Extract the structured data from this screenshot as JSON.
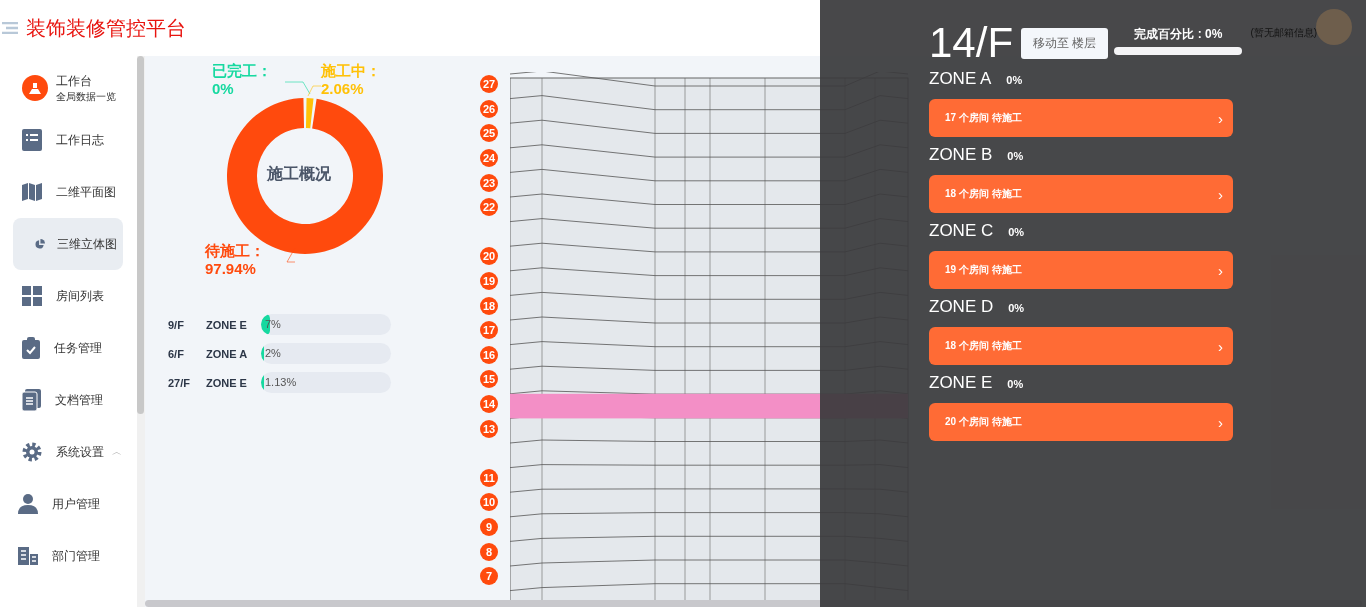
{
  "header": {
    "title": "装饰装修管控平台"
  },
  "sidebar": {
    "items": [
      {
        "label": "工作台",
        "subtitle": "全局数据一览",
        "kind": "home",
        "selected": false
      },
      {
        "label": "工作日志",
        "kind": "log",
        "selected": false
      },
      {
        "label": "二维平面图",
        "kind": "map",
        "selected": false
      },
      {
        "label": "三维立体图",
        "kind": "pie3d",
        "selected": true
      },
      {
        "label": "房间列表",
        "kind": "grid",
        "selected": false
      },
      {
        "label": "任务管理",
        "kind": "task",
        "selected": false
      },
      {
        "label": "文档管理",
        "kind": "doc",
        "selected": false
      },
      {
        "label": "系统设置",
        "kind": "gear",
        "caret": "︿",
        "selected": false
      },
      {
        "label": "用户管理",
        "kind": "user",
        "selected": false
      },
      {
        "label": "部门管理",
        "kind": "dept",
        "selected": false
      }
    ]
  },
  "overview": {
    "center_label": "施工概况",
    "label_separator": "：",
    "chart_data": {
      "type": "donut",
      "categories": [
        "已完工",
        "施工中",
        "待施工"
      ],
      "values": [
        0,
        2.06,
        97.94
      ],
      "value_labels": [
        "0%",
        "2.06%",
        "97.94%"
      ],
      "colors": [
        "#16d9a0",
        "#ffc107",
        "#ff4a0d"
      ]
    }
  },
  "progress": [
    {
      "floor": "9/F",
      "zone": "ZONE E",
      "percent": "7%",
      "level": 0.07
    },
    {
      "floor": "6/F",
      "zone": "ZONE A",
      "percent": "2%",
      "level": 0.02
    },
    {
      "floor": "27/F",
      "zone": "ZONE E",
      "percent": "1.13%",
      "level": 0.0113
    }
  ],
  "floors": [
    {
      "kind": "labeled",
      "label": "27",
      "selected": false
    },
    {
      "kind": "labeled",
      "label": "26",
      "selected": false
    },
    {
      "kind": "labeled",
      "label": "25",
      "selected": false
    },
    {
      "kind": "labeled",
      "label": "24",
      "selected": false
    },
    {
      "kind": "labeled",
      "label": "23",
      "selected": false
    },
    {
      "kind": "labeled",
      "label": "22",
      "selected": false
    },
    {
      "kind": "unlabeled"
    },
    {
      "kind": "labeled",
      "label": "20",
      "selected": false
    },
    {
      "kind": "labeled",
      "label": "19",
      "selected": false
    },
    {
      "kind": "labeled",
      "label": "18",
      "selected": false
    },
    {
      "kind": "labeled",
      "label": "17",
      "selected": false
    },
    {
      "kind": "labeled",
      "label": "16",
      "selected": false
    },
    {
      "kind": "labeled",
      "label": "15",
      "selected": false
    },
    {
      "kind": "labeled",
      "label": "14",
      "selected": true
    },
    {
      "kind": "labeled",
      "label": "13",
      "selected": false
    },
    {
      "kind": "unlabeled"
    },
    {
      "kind": "labeled",
      "label": "11",
      "selected": false
    },
    {
      "kind": "labeled",
      "label": "10",
      "selected": false
    },
    {
      "kind": "labeled",
      "label": "9",
      "selected": false
    },
    {
      "kind": "labeled",
      "label": "8",
      "selected": false
    },
    {
      "kind": "labeled",
      "label": "7",
      "selected": false
    }
  ],
  "drawer": {
    "floor": "14/F",
    "user_hint": "(暂无邮箱信息)",
    "move_button": "移动至 楼层",
    "completion_label": "完成百分比 : 0%",
    "completion": {
      "level": 0
    },
    "zones": [
      {
        "name": "ZONE A",
        "percent": "0%",
        "status": "17 个房间 待施工",
        "chevron": "›"
      },
      {
        "name": "ZONE B",
        "percent": "0%",
        "status": "18 个房间 待施工",
        "chevron": "›"
      },
      {
        "name": "ZONE C",
        "percent": "0%",
        "status": "19 个房间 待施工",
        "chevron": "›"
      },
      {
        "name": "ZONE D",
        "percent": "0%",
        "status": "18 个房间 待施工",
        "chevron": "›"
      },
      {
        "name": "ZONE E",
        "percent": "0%",
        "status": "20 个房间 待施工",
        "chevron": "›"
      }
    ]
  }
}
